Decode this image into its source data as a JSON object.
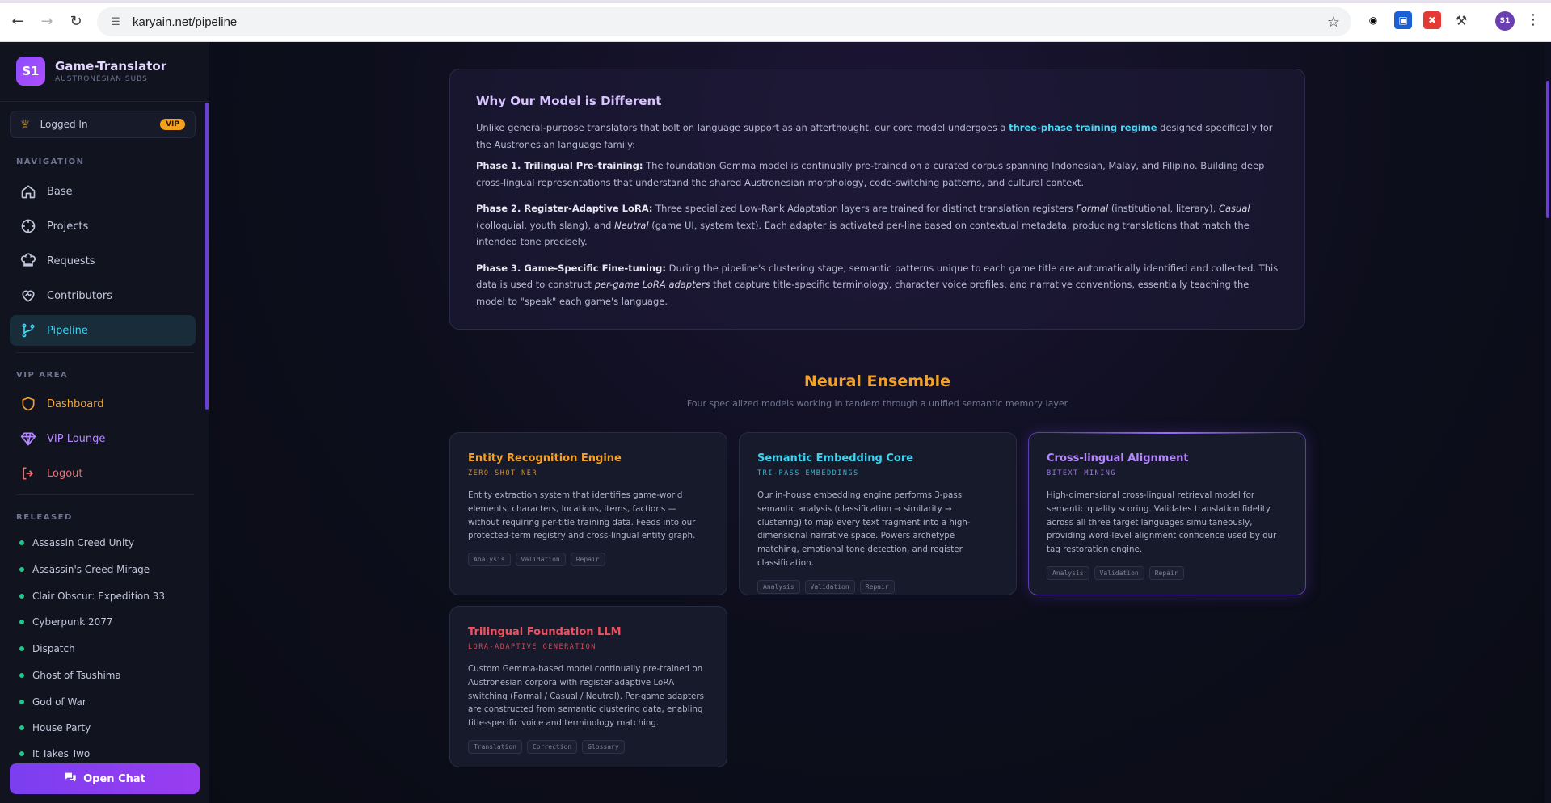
{
  "browser": {
    "url": "karyain.net/pipeline",
    "profile_initials": "S1"
  },
  "brand": {
    "logo": "S1",
    "title": "Game-Translator",
    "subtitle": "AUSTRONESIAN SUBS"
  },
  "status": {
    "label": "Logged In",
    "badge": "VIP"
  },
  "nav": {
    "section": "NAVIGATION",
    "items": [
      {
        "label": "Base",
        "icon": "home-icon"
      },
      {
        "label": "Projects",
        "icon": "crosshair-icon"
      },
      {
        "label": "Requests",
        "icon": "chef-hat-icon"
      },
      {
        "label": "Contributors",
        "icon": "heart-handshake-icon"
      },
      {
        "label": "Pipeline",
        "icon": "git-branch-icon",
        "active": true
      }
    ]
  },
  "vip": {
    "section": "VIP AREA",
    "items": [
      {
        "label": "Dashboard",
        "icon": "shield-icon"
      },
      {
        "label": "VIP Lounge",
        "icon": "diamond-icon"
      },
      {
        "label": "Logout",
        "icon": "logout-icon"
      }
    ]
  },
  "released": {
    "section": "RELEASED",
    "items": [
      "Assassin Creed Unity",
      "Assassin's Creed Mirage",
      "Clair Obscur: Expedition 33",
      "Cyberpunk 2077",
      "Dispatch",
      "Ghost of Tsushima",
      "God of War",
      "House Party",
      "It Takes Two"
    ]
  },
  "chat": {
    "label": "Open Chat"
  },
  "why": {
    "title": "Why Our Model is Different",
    "intro_pre": "Unlike general-purpose translators that bolt on language support as an afterthought, our core model undergoes a ",
    "intro_highlight": "three-phase training regime",
    "intro_post": " designed specifically for the Austronesian language family:",
    "phase1_title": "Phase 1. Trilingual Pre-training:",
    "phase1_text": " The foundation Gemma model is continually pre-trained on a curated corpus spanning Indonesian, Malay, and Filipino. Building deep cross-lingual representations that understand the shared Austronesian morphology, code-switching patterns, and cultural context.",
    "phase2_title": "Phase 2. Register-Adaptive LoRA:",
    "phase2_a": " Three specialized Low-Rank Adaptation layers are trained for distinct translation registers ",
    "phase2_formal": "Formal",
    "phase2_b": " (institutional, literary), ",
    "phase2_casual": "Casual",
    "phase2_c": " (colloquial, youth slang), and ",
    "phase2_neutral": "Neutral",
    "phase2_d": " (game UI, system text). Each adapter is activated per-line based on contextual metadata, producing translations that match the intended tone precisely.",
    "phase3_title": "Phase 3. Game-Specific Fine-tuning:",
    "phase3_a": " During the pipeline's clustering stage, semantic patterns unique to each game title are automatically identified and collected. This data is used to construct ",
    "phase3_em": "per-game LoRA adapters",
    "phase3_b": " that capture title-specific terminology, character voice profiles, and narrative conventions, essentially teaching the model to \"speak\" each game's language."
  },
  "ensemble": {
    "title": "Neural Ensemble",
    "subtitle": "Four specialized models working in tandem through a unified semantic memory layer",
    "colors": {
      "gold": "#f4a12a",
      "cyan": "#3fd3f0",
      "purple": "#b688ff",
      "red": "#f0505f"
    },
    "cards": [
      {
        "title": "Entity Recognition Engine",
        "tag": "ZERO-SHOT NER",
        "text": "Entity extraction system that identifies game-world elements, characters, locations, items, factions — without requiring per-title training data. Feeds into our protected-term registry and cross-lingual entity graph.",
        "chips": [
          "Analysis",
          "Validation",
          "Repair"
        ]
      },
      {
        "title": "Semantic Embedding Core",
        "tag": "TRI-PASS EMBEDDINGS",
        "text": "Our in-house embedding engine performs 3-pass semantic analysis (classification → similarity → clustering) to map every text fragment into a high-dimensional narrative space. Powers archetype matching, emotional tone detection, and register classification.",
        "chips": [
          "Analysis",
          "Validation",
          "Repair"
        ]
      },
      {
        "title": "Cross-lingual Alignment",
        "tag": "BITEXT MINING",
        "text": "High-dimensional cross-lingual retrieval model for semantic quality scoring. Validates translation fidelity across all three target languages simultaneously, providing word-level alignment confidence used by our tag restoration engine.",
        "chips": [
          "Analysis",
          "Validation",
          "Repair"
        ]
      },
      {
        "title": "Trilingual Foundation LLM",
        "tag": "LORA-ADAPTIVE GENERATION",
        "text": "Custom Gemma-based model continually pre-trained on Austronesian corpora with register-adaptive LoRA switching (Formal / Casual / Neutral). Per-game adapters are constructed from semantic clustering data, enabling title-specific voice and terminology matching.",
        "chips": [
          "Translation",
          "Correction",
          "Glossary"
        ]
      }
    ]
  }
}
